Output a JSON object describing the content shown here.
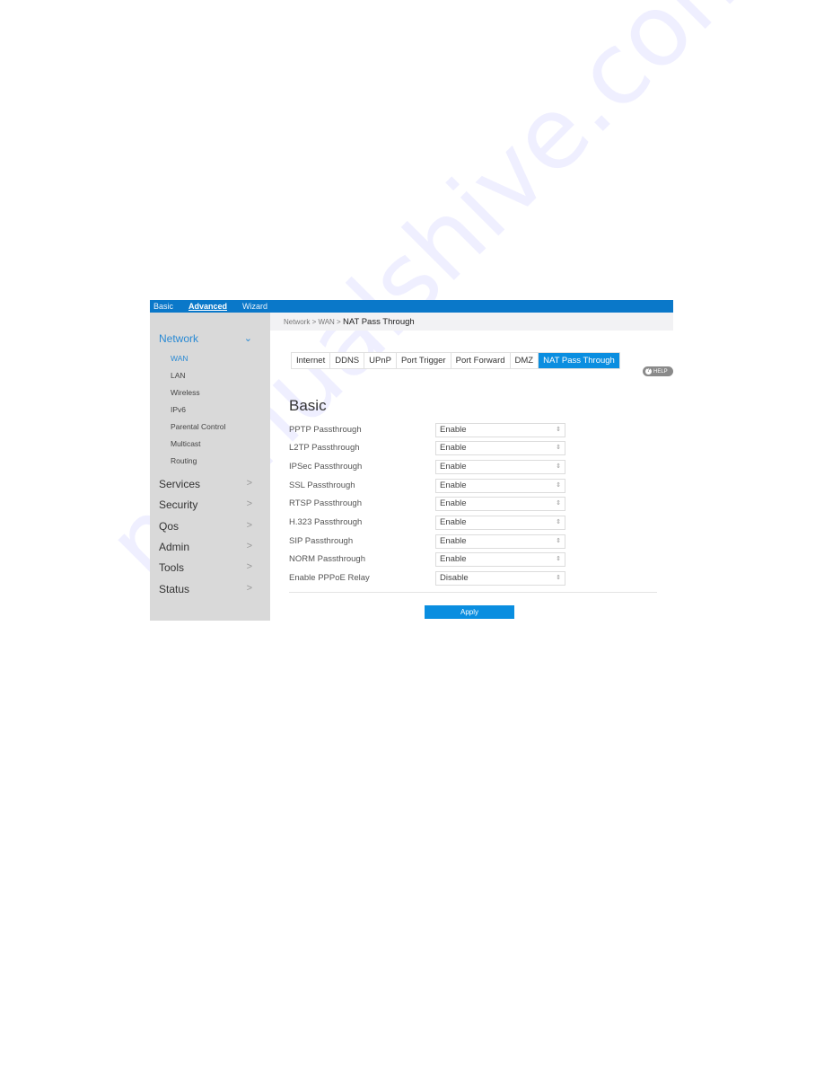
{
  "topbar": {
    "items": [
      {
        "label": "Basic",
        "active": false
      },
      {
        "label": "Advanced",
        "active": true
      },
      {
        "label": "Wizard",
        "active": false
      }
    ]
  },
  "breadcrumb": {
    "path": "Network > WAN > ",
    "current": "NAT Pass Through"
  },
  "sidebar": {
    "network": {
      "label": "Network",
      "icon": "chevron-down-icon",
      "glyph": "⌄"
    },
    "network_sub": [
      "WAN",
      "LAN",
      "Wireless",
      "IPv6",
      "Parental Control",
      "Multicast",
      "Routing"
    ],
    "groups": [
      "Services",
      "Security",
      "Qos",
      "Admin",
      "Tools",
      "Status"
    ],
    "chevron_glyph": ">"
  },
  "tabs": [
    "Internet",
    "DDNS",
    "UPnP",
    "Port Trigger",
    "Port Forward",
    "DMZ",
    "NAT Pass Through"
  ],
  "help": {
    "label": "HELP",
    "icon_glyph": "?"
  },
  "form": {
    "title": "Basic",
    "rows": [
      {
        "label": "PPTP Passthrough",
        "value": "Enable"
      },
      {
        "label": "L2TP Passthrough",
        "value": "Enable"
      },
      {
        "label": "IPSec Passthrough",
        "value": "Enable"
      },
      {
        "label": "SSL Passthrough",
        "value": "Enable"
      },
      {
        "label": "RTSP Passthrough",
        "value": "Enable"
      },
      {
        "label": "H.323 Passthrough",
        "value": "Enable"
      },
      {
        "label": "SIP Passthrough",
        "value": "Enable"
      },
      {
        "label": "NORM Passthrough",
        "value": "Enable"
      },
      {
        "label": "Enable PPPoE Relay",
        "value": "Disable"
      }
    ],
    "select_arrow_glyph": "⌃⌄",
    "apply_label": "Apply"
  },
  "watermark": "manualshive.com",
  "colors": {
    "accent": "#0a8ee0",
    "topbar": "#0a78c9",
    "sidebar": "#d9d9d9"
  }
}
